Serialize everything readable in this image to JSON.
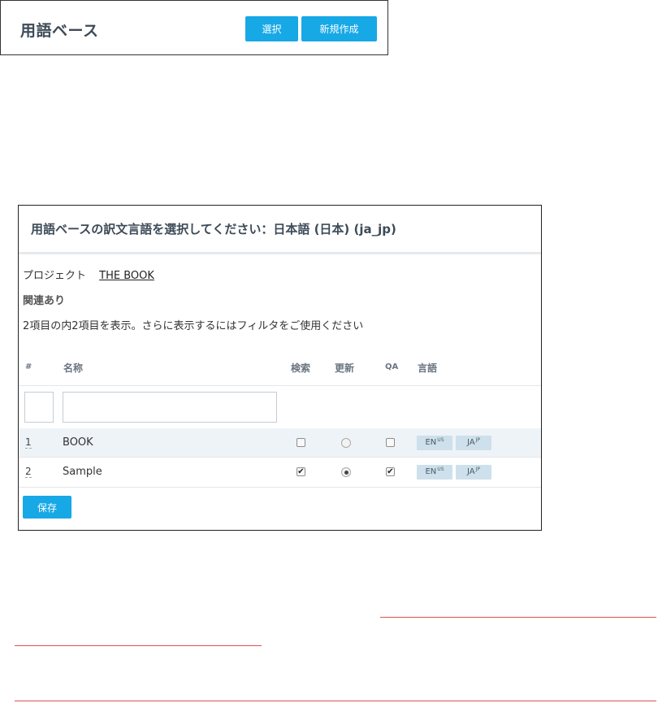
{
  "termbase_panel": {
    "title": "用語ベース",
    "select_button": "選択",
    "new_button": "新規作成"
  },
  "dialog": {
    "title": "用語ベースの訳文言語を選択してください：日本語 (日本) (ja_jp)",
    "project_label": "プロジェクト",
    "project_name": "THE BOOK",
    "related_label": "関連あり",
    "count_text": "2項目の内2項目を表示。さらに表示するにはフィルタをご使用ください",
    "columns": {
      "hash": "#",
      "name": "名称",
      "search": "検索",
      "update": "更新",
      "qa": "QA",
      "language": "言語"
    },
    "filter_name_placeholder": "",
    "rows": [
      {
        "number": "1",
        "name": "BOOK",
        "search_checked": false,
        "update_selected": false,
        "qa_checked": false,
        "lang_tags": [
          {
            "code": "EN",
            "region": "US"
          },
          {
            "code": "JA",
            "region": "JP"
          }
        ]
      },
      {
        "number": "2",
        "name": "Sample",
        "search_checked": true,
        "update_selected": true,
        "qa_checked": true,
        "lang_tags": [
          {
            "code": "EN",
            "region": "US"
          },
          {
            "code": "JA",
            "region": "JP"
          }
        ]
      }
    ],
    "save_button": "保存"
  },
  "colors": {
    "accent": "#17a8e6",
    "title_text": "#3d4b57",
    "row_highlight": "#eef3f8",
    "tag_bg": "#cde0ec",
    "red_underline": "#d9534f"
  }
}
